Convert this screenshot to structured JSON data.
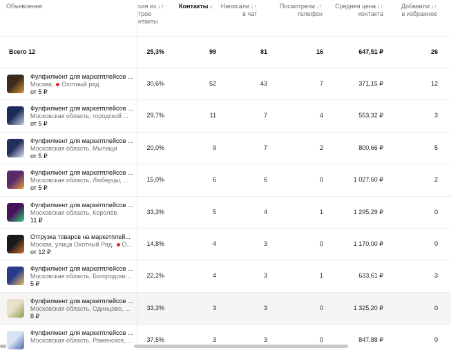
{
  "header": {
    "ads": "Объявления",
    "conversion_line1": "сия из ↓↑",
    "conversion_line2": "тров",
    "conversion_line3": "нтакты",
    "contacts": "Контакты",
    "contacts_arrow": "↓",
    "chat_line1": "Написали",
    "chat_line2": "в чат",
    "phone_line1": "Посмотрели",
    "phone_line2": "телефон",
    "price_line1": "Средняя цена",
    "price_line2": "контакта",
    "fav_line1": "Добавили",
    "fav_line2": "в избранное",
    "sort_icon": "↓↑"
  },
  "total": {
    "label": "Всего 12",
    "conversion": "25,3%",
    "contacts": "99",
    "chat": "81",
    "phone": "16",
    "price": "647,51 ₽",
    "fav": "26"
  },
  "rows": [
    {
      "title": "Фулфилмент для маркетплейсов ...",
      "location": "Москва,",
      "metro": "Охотный ряд",
      "price": "от 5 ₽",
      "conversion": "30,6%",
      "contacts": "52",
      "chat": "43",
      "phone": "7",
      "avg_price": "371,15 ₽",
      "fav": "12",
      "thumb_colors": [
        "#3a2a1a",
        "#d89a3a"
      ]
    },
    {
      "title": "Фулфилмент для маркетплейсов ...",
      "location": "Московская область, городской ...",
      "metro": "",
      "price": "от 5 ₽",
      "conversion": "29,7%",
      "contacts": "11",
      "chat": "7",
      "phone": "4",
      "avg_price": "553,32 ₽",
      "fav": "3",
      "thumb_colors": [
        "#1c2b5a",
        "#c8d0e0"
      ]
    },
    {
      "title": "Фулфилмент для маркетплейсов ...",
      "location": "Московская область, Мытищи",
      "metro": "",
      "price": "от 5 ₽",
      "conversion": "20,0%",
      "contacts": "9",
      "chat": "7",
      "phone": "2",
      "avg_price": "800,66 ₽",
      "fav": "5",
      "thumb_colors": [
        "#23305e",
        "#e5e5ee"
      ]
    },
    {
      "title": "Фулфилмент для маркетплейсов ...",
      "location": "Московская область, Люберцы, ...",
      "metro": "",
      "price": "от 5 ₽",
      "conversion": "15,0%",
      "contacts": "6",
      "chat": "6",
      "phone": "0",
      "avg_price": "1 027,60 ₽",
      "fav": "2",
      "thumb_colors": [
        "#5a2a6a",
        "#e8a040"
      ]
    },
    {
      "title": "Фулфилмент для маркетплейсов ...",
      "location": "Московская область, Королёв",
      "metro": "",
      "price": "11 ₽",
      "conversion": "33,3%",
      "contacts": "5",
      "chat": "4",
      "phone": "1",
      "avg_price": "1 295,29 ₽",
      "fav": "0",
      "thumb_colors": [
        "#4a0f5a",
        "#2ad07a"
      ]
    },
    {
      "title": "Отгрузка товаров на маркетплей...",
      "location": "Москва, улица Охотный Ряд,",
      "metro": "О...",
      "price": "от 12 ₽",
      "conversion": "14,8%",
      "contacts": "4",
      "chat": "3",
      "phone": "0",
      "avg_price": "1 170,00 ₽",
      "fav": "0",
      "thumb_colors": [
        "#1a1a1a",
        "#d07030"
      ]
    },
    {
      "title": "Фулфилмент для маркетплейсов ...",
      "location": "Московская область, Богородски...",
      "metro": "",
      "price": "5 ₽",
      "conversion": "22,2%",
      "contacts": "4",
      "chat": "3",
      "phone": "1",
      "avg_price": "633,61 ₽",
      "fav": "3",
      "thumb_colors": [
        "#2a3a8a",
        "#f0c060"
      ]
    },
    {
      "title": "Фулфилмент для маркетплейсов ...",
      "location": "Московская область, Одинцово, ...",
      "metro": "",
      "price": "8 ₽",
      "conversion": "33,3%",
      "contacts": "3",
      "chat": "3",
      "phone": "0",
      "avg_price": "1 325,20 ₽",
      "fav": "0",
      "thumb_colors": [
        "#e8e0c8",
        "#8aa050"
      ]
    },
    {
      "title": "Фулфилмент для маркетплейсов ...",
      "location": "Московская область, Раменское, ...",
      "metro": "",
      "price": "",
      "conversion": "37,5%",
      "contacts": "3",
      "chat": "3",
      "phone": "0",
      "avg_price": "847,88 ₽",
      "fav": "0",
      "thumb_colors": [
        "#d8e4f4",
        "#4a6aa8"
      ]
    }
  ]
}
